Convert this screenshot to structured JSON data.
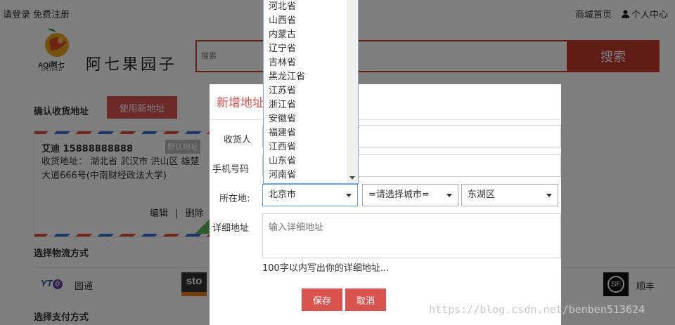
{
  "topbar": {
    "login": "请登录",
    "register": "免费注册",
    "mall_home": "商城首页",
    "personal_center": "个人中心"
  },
  "logo": {
    "brand_en": "AQI阿七",
    "brand_sub": "ORCHARD",
    "brand_cn": "阿七果园子"
  },
  "search": {
    "placeholder": "搜索",
    "button": "搜索"
  },
  "address_section": {
    "title": "确认收货地址",
    "new_button": "使用新地址"
  },
  "address_card": {
    "name_phone": "艾迪 15888888888",
    "default_tag": "默认地址",
    "detail": "收货地址：  湖北省 武汉市 洪山区 雄楚大道666号(中南财经政法大学)",
    "edit": "编辑",
    "sep": "|",
    "delete": "删除"
  },
  "logistics": {
    "title": "选择物流方式",
    "yt_label": "圆通",
    "sto_text": "sto",
    "sf_label": "顺丰",
    "sf_text": "SF"
  },
  "payment": {
    "title": "选择支付方式"
  },
  "modal": {
    "title": "新增地址",
    "receiver_label": "收货人",
    "phone_label": "手机号码",
    "location_label": "所在地:",
    "detail_label": "详细地址",
    "province_value": "北京市",
    "city_value": "=请选择城市=",
    "district_value": "东湖区",
    "detail_placeholder": "输入详细地址",
    "hint": "100字以内写出你的详细地址...",
    "save": "保存",
    "cancel": "取消"
  },
  "province_dropdown": [
    "河北省",
    "山西省",
    "内蒙古",
    "辽宁省",
    "吉林省",
    "黑龙江省",
    "江苏省",
    "浙江省",
    "安徽省",
    "福建省",
    "江西省",
    "山东省",
    "河南省"
  ],
  "watermark": "https://blog.csdn.net/benben513624",
  "colors": {
    "accent": "#d9534f",
    "search_red": "#c0392b",
    "overlay": "rgba(0,0,0,0.5)"
  }
}
